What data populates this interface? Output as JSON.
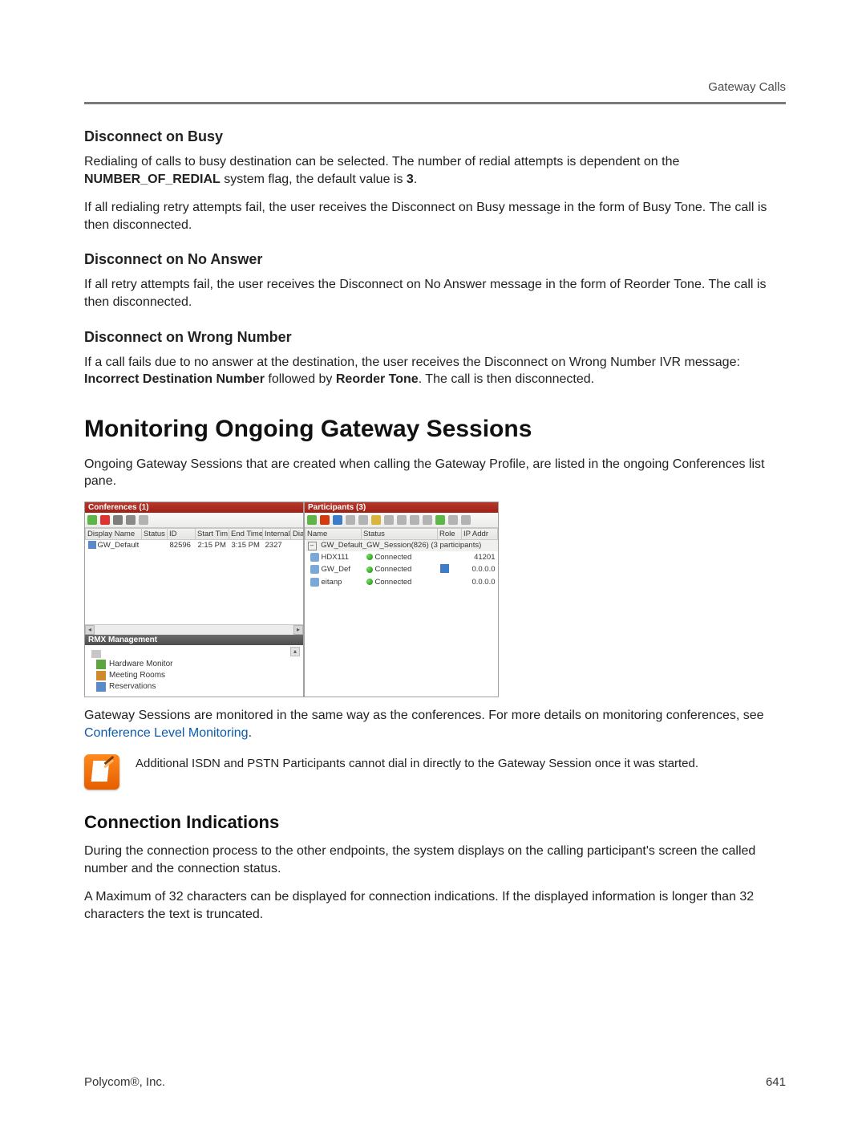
{
  "header": {
    "right": "Gateway Calls"
  },
  "sec1": {
    "title": "Disconnect on Busy",
    "p1a": "Redialing of calls to busy destination can be selected. The number of redial attempts is dependent on the ",
    "p1b": "NUMBER_OF_REDIAL",
    "p1c": " system flag, the default value is ",
    "p1d": "3",
    "p1e": ".",
    "p2": "If all redialing retry attempts fail, the user receives the Disconnect on Busy message in the form of Busy Tone. The call is then disconnected."
  },
  "sec2": {
    "title": "Disconnect on No Answer",
    "p1": "If all retry attempts fail, the user receives the Disconnect on No Answer message in the form of Reorder Tone. The call is then disconnected."
  },
  "sec3": {
    "title": "Disconnect on Wrong Number",
    "p1a": "If a call fails due to no answer at the destination, the user receives the Disconnect on Wrong Number IVR message: ",
    "p1b": "Incorrect Destination Number",
    "p1c": " followed by ",
    "p1d": "Reorder Tone",
    "p1e": ". The call is then disconnected."
  },
  "main": {
    "title": "Monitoring Ongoing Gateway Sessions",
    "p1": "Ongoing Gateway Sessions that are created when calling the Gateway Profile, are listed in the ongoing Conferences list pane.",
    "p2a": "Gateway Sessions are monitored in the same way as the conferences. For more details on monitoring conferences, see ",
    "p2link": "Conference Level Monitoring",
    "p2b": ".",
    "note": "Additional ISDN and PSTN Participants cannot dial in directly to the Gateway Session once it was started."
  },
  "sub": {
    "title": "Connection Indications",
    "p1": "During the connection process to the other endpoints, the system displays on the calling participant's screen the called number and the connection status.",
    "p2": "A Maximum of 32 characters can be displayed for connection indications. If the displayed information is longer than 32 characters the text is truncated."
  },
  "footer": {
    "left": "Polycom®, Inc.",
    "right": "641"
  },
  "figure": {
    "conferences": {
      "title": "Conferences (1)",
      "columns": [
        "Display Name",
        "Status",
        "ID",
        "Start Tim",
        "End Time",
        "Internal I",
        "Dial-in"
      ],
      "row": {
        "display_name": "GW_Default",
        "status": "",
        "id": "82596",
        "start": "2:15 PM",
        "end": "3:15 PM",
        "internal": "2327",
        "dialin": ""
      },
      "mgmt_title": "RMX Management",
      "mgmt_items": [
        "Hardware Monitor",
        "Meeting Rooms",
        "Reservations"
      ]
    },
    "participants": {
      "title": "Participants (3)",
      "columns": [
        "Name",
        "Status",
        "Role",
        "IP Addr"
      ],
      "group": "GW_Default_GW_Session(826) (3 participants)",
      "rows": [
        {
          "name": "HDX111",
          "status": "Connected",
          "role": "",
          "ip": "41201"
        },
        {
          "name": "GW_Def",
          "status": "Connected",
          "role": "icon",
          "ip": "0.0.0.0"
        },
        {
          "name": "eitanp",
          "status": "Connected",
          "role": "",
          "ip": "0.0.0.0"
        }
      ]
    }
  }
}
